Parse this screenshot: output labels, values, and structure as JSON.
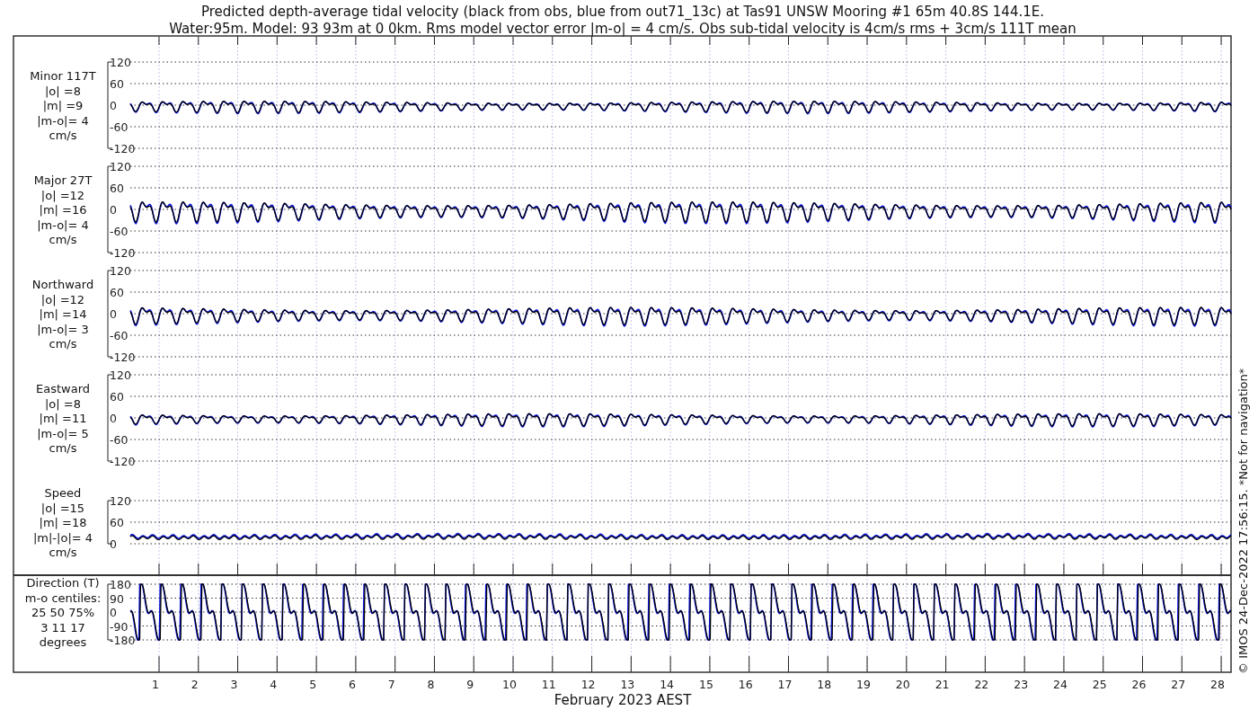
{
  "title_lines": [
    "Predicted depth-average tidal velocity (black from obs, blue from out71_13c) at Tas91 UNSW Mooring #1 65m 40.8S 144.1E.",
    "Water:95m. Model: 93 93m at 0 0km. Rms model vector error |m-o| = 4 cm/s. Obs sub-tidal velocity is 4cm/s rms + 3cm/s 111T mean"
  ],
  "panels": [
    {
      "kind": "signed",
      "label_lines": [
        "Minor 117T",
        "|o| =8",
        "|m| =9",
        "|m-o|= 4",
        "cm/s"
      ],
      "yticks": [
        "120",
        "60",
        "0",
        "-60",
        "-120"
      ]
    },
    {
      "kind": "signed",
      "label_lines": [
        "Major 27T",
        "|o| =12",
        "|m| =16",
        "|m-o|= 4",
        "cm/s"
      ],
      "yticks": [
        "120",
        "60",
        "0",
        "-60",
        "-120"
      ]
    },
    {
      "kind": "signed",
      "label_lines": [
        "Northward",
        "|o| =12",
        "|m| =14",
        "|m-o|= 3",
        "cm/s"
      ],
      "yticks": [
        "120",
        "60",
        "0",
        "-60",
        "-120"
      ]
    },
    {
      "kind": "signed",
      "label_lines": [
        "Eastward",
        "|o| =8",
        "|m| =11",
        "|m-o|= 5",
        "cm/s"
      ],
      "yticks": [
        "120",
        "60",
        "0",
        "-60",
        "-120"
      ]
    },
    {
      "kind": "speed",
      "label_lines": [
        "Speed",
        "|o| =15",
        "|m| =18",
        "|m|-|o|= 4",
        "cm/s"
      ],
      "yticks": [
        "120",
        "60",
        "0"
      ]
    },
    {
      "kind": "direction",
      "label_lines": [
        "Direction (T)",
        "m-o centiles:",
        "25  50  75%",
        "3  11  17",
        "degrees"
      ],
      "yticks": [
        "180",
        "90",
        "0",
        "-90",
        "-180"
      ]
    }
  ],
  "x_axis": {
    "ticks": [
      "1",
      "2",
      "3",
      "4",
      "5",
      "6",
      "7",
      "8",
      "9",
      "10",
      "11",
      "12",
      "13",
      "14",
      "15",
      "16",
      "17",
      "18",
      "19",
      "20",
      "21",
      "22",
      "23",
      "24",
      "25",
      "26",
      "27",
      "28"
    ],
    "label": "February 2023 AEST"
  },
  "side_note": "© IMOS 24-Dec-2022 17:56:15.  *Not for navigation*"
}
